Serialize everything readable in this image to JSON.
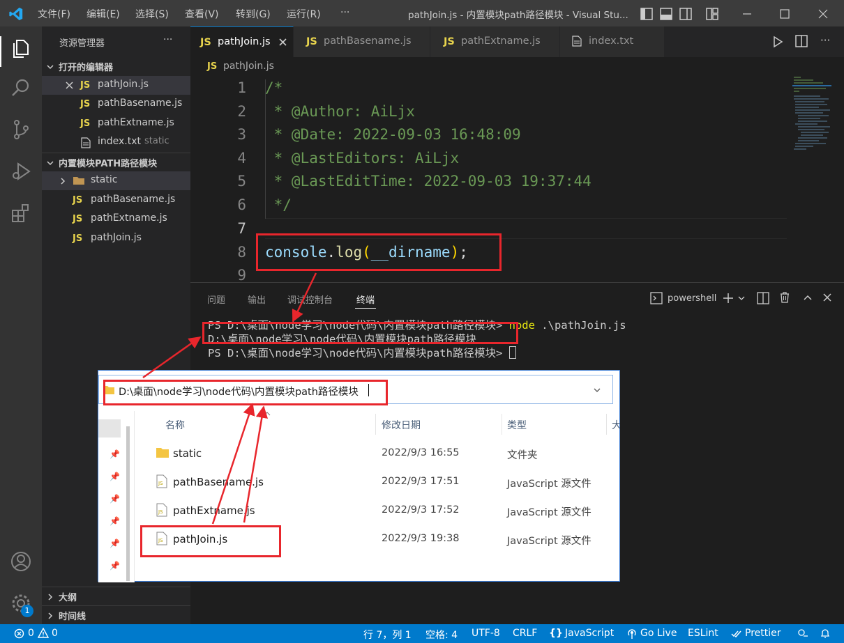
{
  "titlebar": {
    "menu": [
      "文件(F)",
      "编辑(E)",
      "选择(S)",
      "查看(V)",
      "转到(G)",
      "运行(R)",
      "···"
    ],
    "title": "pathJoin.js - 内置模块path路径模块 - Visual Stu..."
  },
  "sidebar": {
    "header": "资源管理器",
    "more": "···",
    "open_editors_title": "打开的编辑器",
    "open_editors": [
      {
        "icon": "JS",
        "label": "pathJoin.js",
        "desc": ""
      },
      {
        "icon": "JS",
        "label": "pathBasename.js",
        "desc": ""
      },
      {
        "icon": "JS",
        "label": "pathExtname.js",
        "desc": ""
      },
      {
        "icon": "txt",
        "label": "index.txt",
        "desc": "static"
      }
    ],
    "folder_title": "内置模块PATH路径模块",
    "folder_items": [
      {
        "icon": "folder",
        "label": "static"
      },
      {
        "icon": "JS",
        "label": "pathBasename.js"
      },
      {
        "icon": "JS",
        "label": "pathExtname.js"
      },
      {
        "icon": "JS",
        "label": "pathJoin.js"
      }
    ],
    "outline": "大纲",
    "timeline": "时间线"
  },
  "tabs": [
    {
      "icon": "JS",
      "label": "pathJoin.js",
      "active": true
    },
    {
      "icon": "JS",
      "label": "pathBasename.js",
      "active": false
    },
    {
      "icon": "JS",
      "label": "pathExtname.js",
      "active": false
    },
    {
      "icon": "txt",
      "label": "index.txt",
      "active": false
    }
  ],
  "breadcrumb": {
    "icon": "JS",
    "label": "pathJoin.js"
  },
  "editor": {
    "line_numbers": [
      "1",
      "2",
      "3",
      "4",
      "5",
      "6",
      "7",
      "8",
      "9"
    ],
    "lines": [
      "/*",
      " * @Author: AiLjx",
      " * @Date: 2022-09-03 16:48:09",
      " * @LastEditors: AiLjx",
      " * @LastEditTime: 2022-09-03 19:37:44",
      " */",
      "",
      "",
      ""
    ],
    "code_line8": {
      "obj": "console",
      "dot": ".",
      "fn": "log",
      "open": "(",
      "arg": "__dirname",
      "close": ")",
      "semi": ";"
    }
  },
  "panel": {
    "tabs": [
      "问题",
      "输出",
      "调试控制台",
      "终端"
    ],
    "active_tab": "终端",
    "shell": "powershell",
    "terminal": {
      "line1_prompt": "PS D:\\桌面\\node学习\\node代码\\内置模块path路径模块> ",
      "line1_cmd": "node",
      "line1_arg": " .\\pathJoin.js",
      "line2": "D:\\桌面\\node学习\\node代码\\内置模块path路径模块",
      "line3_prompt": "PS D:\\桌面\\node学习\\node代码\\内置模块path路径模块> "
    }
  },
  "explorer_window": {
    "address": "D:\\桌面\\node学习\\node代码\\内置模块path路径模块",
    "columns": [
      "名称",
      "修改日期",
      "类型",
      "大"
    ],
    "files": [
      {
        "icon": "folder",
        "name": "static",
        "date": "2022/9/3 16:55",
        "type": "文件夹"
      },
      {
        "icon": "js-file",
        "name": "pathBasename.js",
        "date": "2022/9/3 17:51",
        "type": "JavaScript 源文件"
      },
      {
        "icon": "js-file",
        "name": "pathExtname.js",
        "date": "2022/9/3 17:52",
        "type": "JavaScript 源文件"
      },
      {
        "icon": "js-file",
        "name": "pathJoin.js",
        "date": "2022/9/3 19:38",
        "type": "JavaScript 源文件"
      }
    ]
  },
  "statusbar": {
    "errors": "0",
    "warnings": "0",
    "position": "行 7，列 1",
    "spaces": "空格: 4",
    "encoding": "UTF-8",
    "eol": "CRLF",
    "language": "JavaScript",
    "golive": "Go Live",
    "eslint": "ESLint",
    "prettier": "Prettier"
  },
  "accounts_badge": "1",
  "colors": {
    "accent": "#007acc",
    "annotation_red": "#e8262c",
    "js_yellow": "#e8d44d",
    "comment_green": "#6a9955"
  }
}
